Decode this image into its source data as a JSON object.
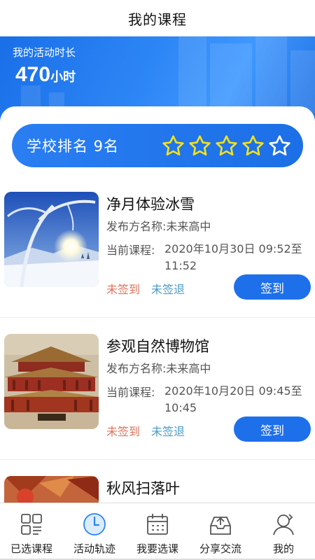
{
  "nav": {
    "title": "我的课程"
  },
  "banner": {
    "label": "我的活动时长",
    "value": "470",
    "unit": "小时"
  },
  "ranking": {
    "text": "学校排名 9名",
    "star_count": 5
  },
  "courses": [
    {
      "title": "净月体验冰雪",
      "publisher": "发布方名称:未来高中",
      "time_label": "当前课程:",
      "time_value": "2020年10月30日 09:52至11:52",
      "status_sign_in": "未签到",
      "status_sign_out": "未签退",
      "button_label": "签到"
    },
    {
      "title": "参观自然博物馆",
      "publisher": "发布方名称:未来高中",
      "time_label": "当前课程:",
      "time_value": "2020年10月20日 09:45至10:45",
      "status_sign_in": "未签到",
      "status_sign_out": "未签退",
      "button_label": "签到"
    },
    {
      "title": "秋风扫落叶"
    }
  ],
  "tabs": [
    {
      "label": "已选课程",
      "icon": "selected-courses-icon"
    },
    {
      "label": "活动轨迹",
      "icon": "activity-track-icon"
    },
    {
      "label": "我要选课",
      "icon": "calendar-icon"
    },
    {
      "label": "分享交流",
      "icon": "share-inbox-icon"
    },
    {
      "label": "我的",
      "icon": "user-icon"
    }
  ],
  "colors": {
    "primary": "#1e70ea",
    "star": "#f2e21c",
    "sign_in": "#e2745b",
    "sign_out": "#4b9cc8"
  }
}
